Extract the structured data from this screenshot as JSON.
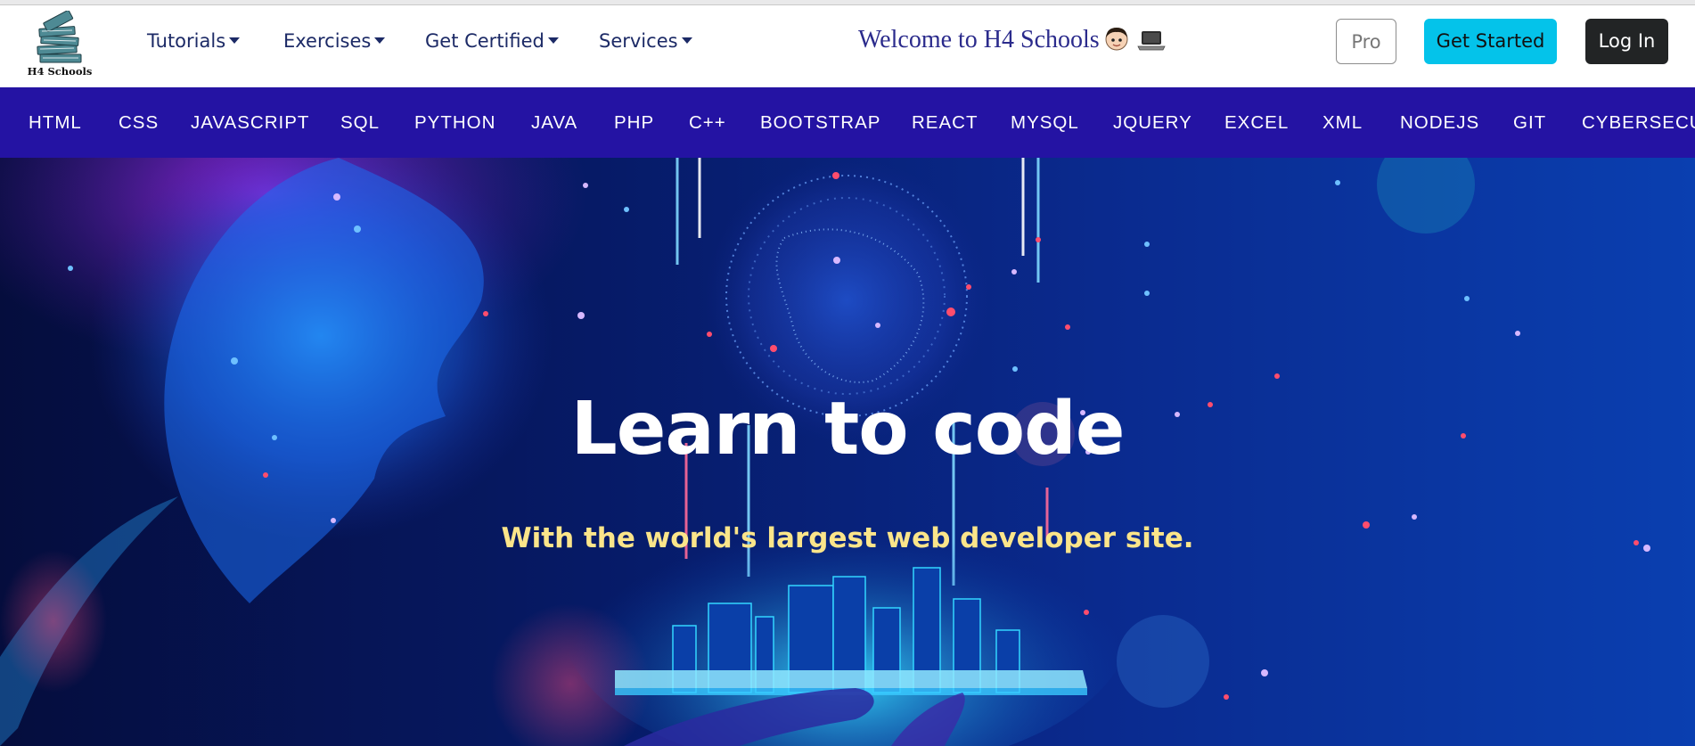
{
  "header": {
    "logo_text": "H4 Schools",
    "nav": [
      {
        "label": "Tutorials"
      },
      {
        "label": "Exercises"
      },
      {
        "label": "Get Certified"
      },
      {
        "label": "Services"
      }
    ],
    "welcome_text": "Welcome to H4 Schools",
    "buttons": {
      "pro": "Pro",
      "get_started": "Get Started",
      "login": "Log In"
    }
  },
  "subnav": {
    "items": [
      "HTML",
      "CSS",
      "JAVASCRIPT",
      "SQL",
      "PYTHON",
      "JAVA",
      "PHP",
      "C++",
      "BOOTSTRAP",
      "REACT",
      "MYSQL",
      "JQUERY",
      "EXCEL",
      "XML",
      "NODEJS",
      "GIT",
      "CYBERSECU"
    ]
  },
  "hero": {
    "title": "Learn to code",
    "subtitle": "With the world's largest web developer site."
  },
  "colors": {
    "subnav_bg": "#2413a3",
    "accent": "#04c3ea",
    "login_bg": "#222425",
    "nav_text": "#1c2a66",
    "hero_subtitle": "#fbe58a"
  },
  "icons": [
    "books-logo-icon",
    "caret-down-icon",
    "boy-face-emoji-icon",
    "laptop-emoji-icon"
  ]
}
